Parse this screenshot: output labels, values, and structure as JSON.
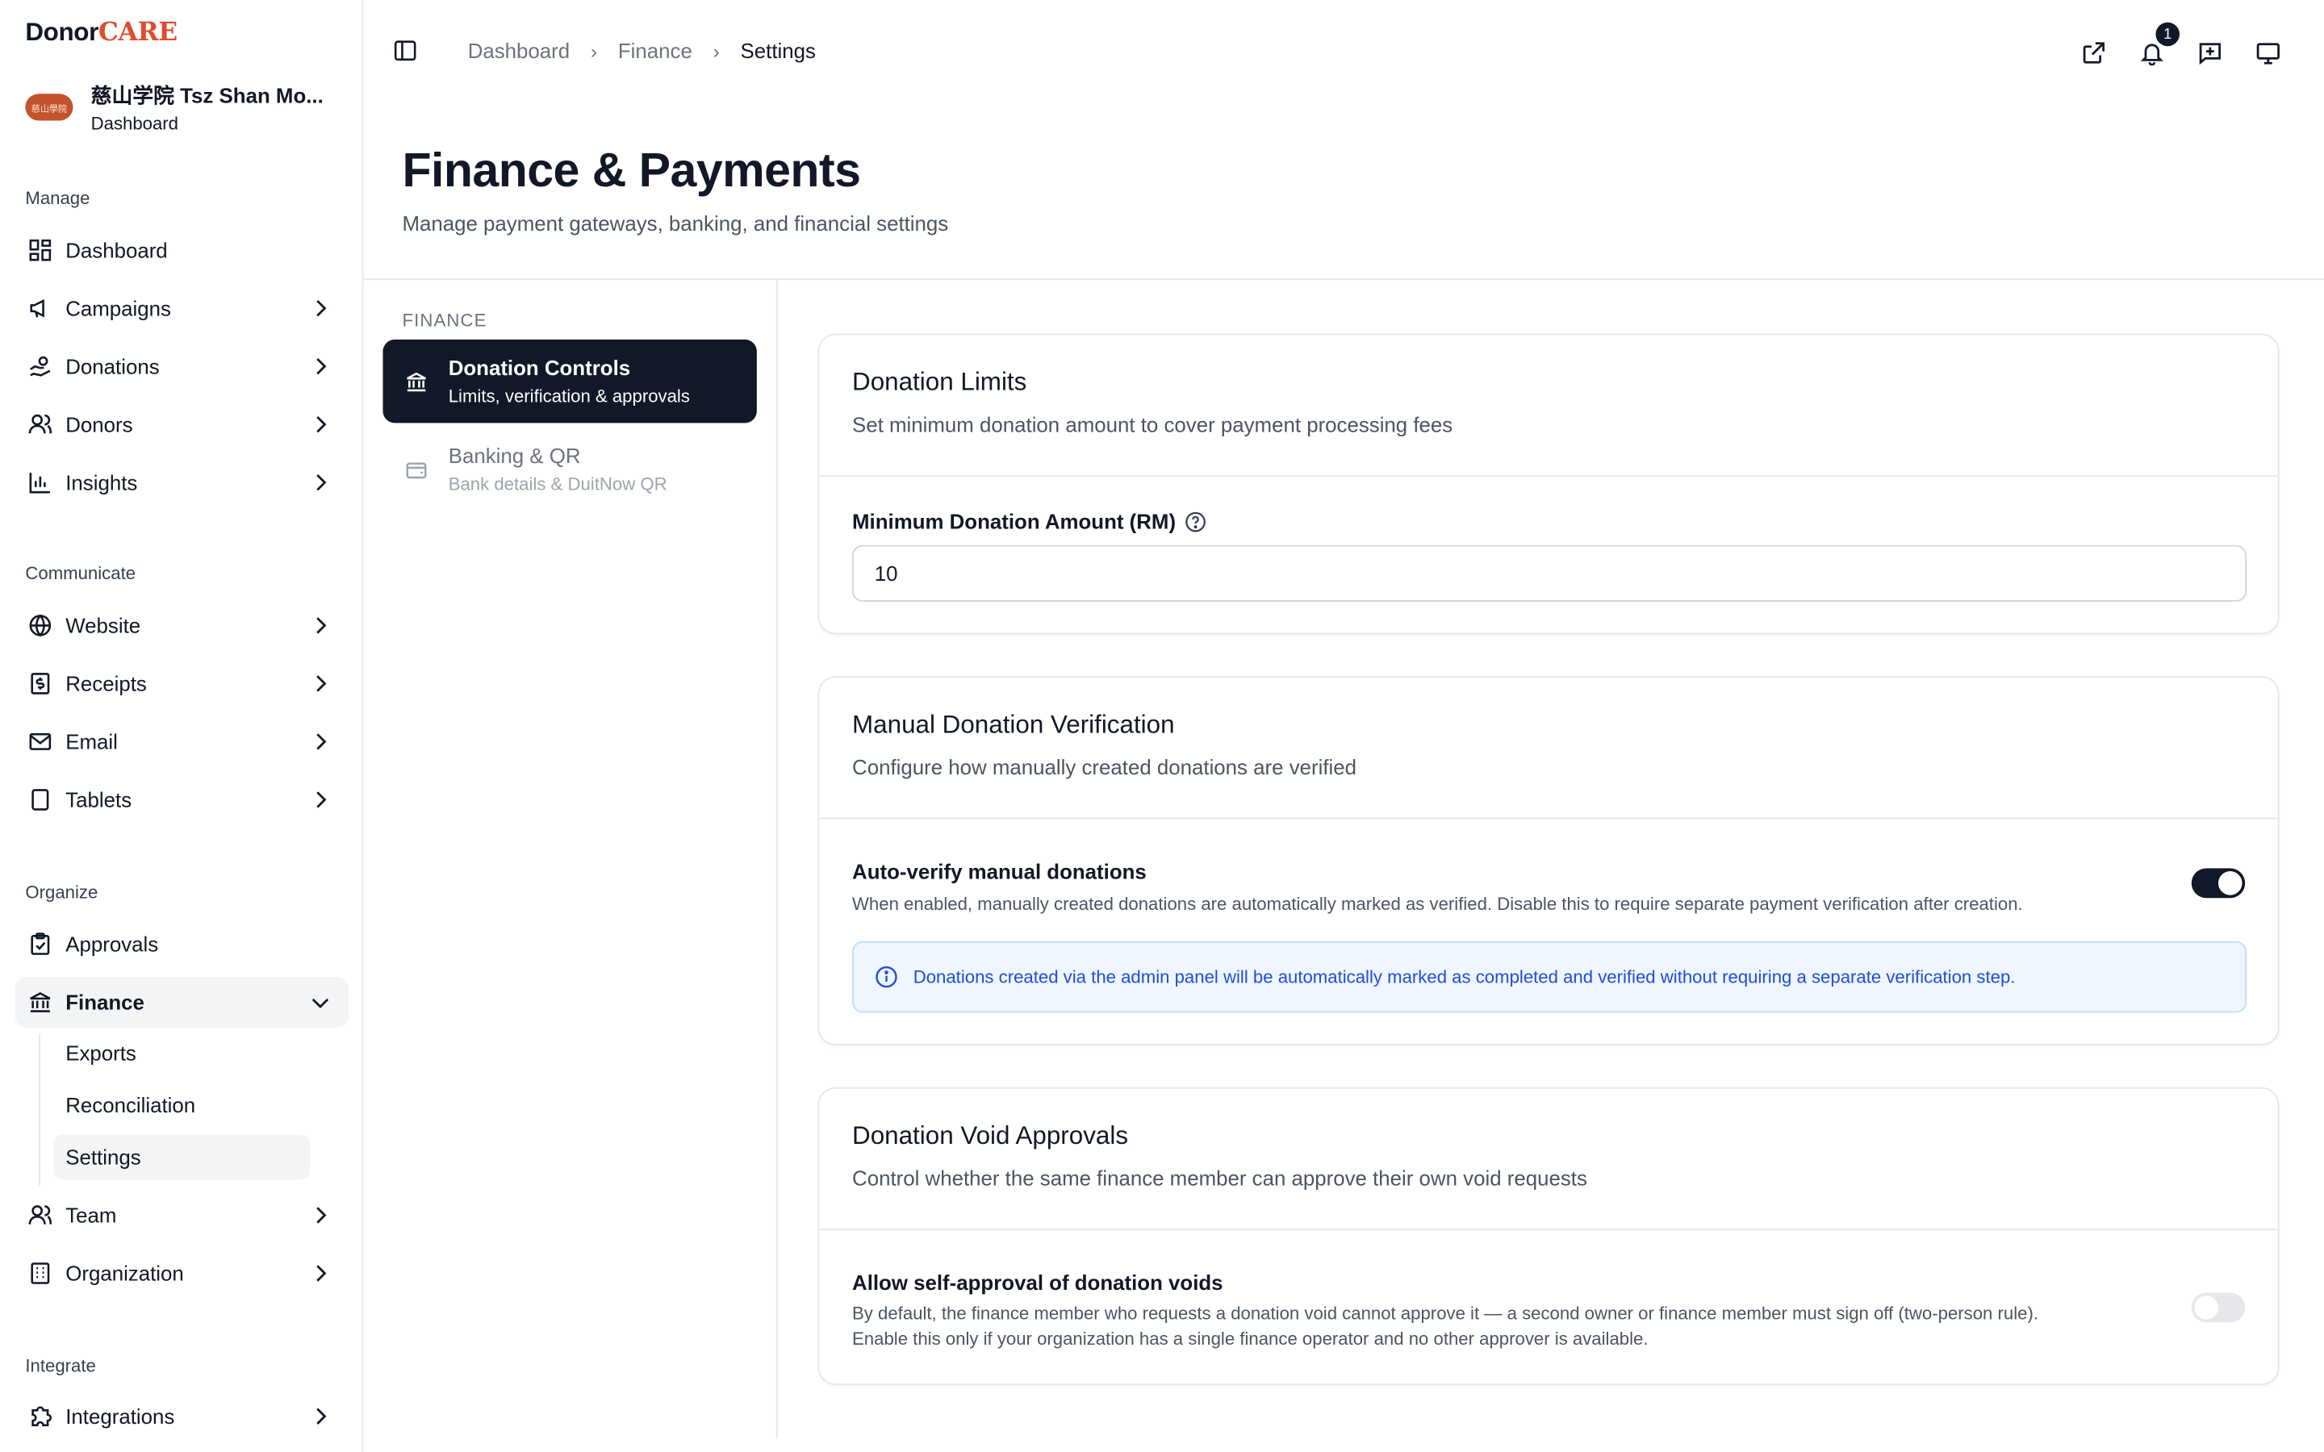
{
  "brand": {
    "part1": "Donor",
    "part2": "CARE"
  },
  "org": {
    "name": "慈山学院 Tsz Shan Mo...",
    "subtitle": "Dashboard",
    "logo_text": "慈山學院"
  },
  "sidebar": {
    "sections": {
      "manage": "Manage",
      "communicate": "Communicate",
      "organize": "Organize",
      "integrate": "Integrate"
    },
    "items": {
      "dashboard": "Dashboard",
      "campaigns": "Campaigns",
      "donations": "Donations",
      "donors": "Donors",
      "insights": "Insights",
      "website": "Website",
      "receipts": "Receipts",
      "email": "Email",
      "tablets": "Tablets",
      "approvals": "Approvals",
      "finance": "Finance",
      "team": "Team",
      "organization": "Organization",
      "integrations": "Integrations"
    },
    "finance_sub": {
      "exports": "Exports",
      "reconciliation": "Reconciliation",
      "settings": "Settings"
    }
  },
  "header": {
    "breadcrumbs": [
      "Dashboard",
      "Finance",
      "Settings"
    ],
    "notification_count": "1"
  },
  "page": {
    "title": "Finance & Payments",
    "subtitle": "Manage payment gateways, banking, and financial settings"
  },
  "settings_nav": {
    "label": "FINANCE",
    "items": [
      {
        "title": "Donation Controls",
        "subtitle": "Limits, verification & approvals",
        "active": true
      },
      {
        "title": "Banking & QR",
        "subtitle": "Bank details & DuitNow QR",
        "active": false
      }
    ]
  },
  "cards": {
    "limits": {
      "title": "Donation Limits",
      "description": "Set minimum donation amount to cover payment processing fees",
      "field_label": "Minimum Donation Amount (RM)",
      "field_value": "10"
    },
    "verification": {
      "title": "Manual Donation Verification",
      "description": "Configure how manually created donations are verified",
      "setting_title": "Auto-verify manual donations",
      "setting_desc": "When enabled, manually created donations are automatically marked as verified. Disable this to require separate payment verification after creation.",
      "enabled": true,
      "info": "Donations created via the admin panel will be automatically marked as completed and verified without requiring a separate verification step."
    },
    "voids": {
      "title": "Donation Void Approvals",
      "description": "Control whether the same finance member can approve their own void requests",
      "setting_title": "Allow self-approval of donation voids",
      "setting_desc_1": "By default, the finance member who requests a donation void cannot approve it — a second owner or finance member must sign off (two-person rule).",
      "setting_desc_2": "Enable this only if your organization has a single finance operator and no other approver is available.",
      "enabled": false
    }
  },
  "colors": {
    "brand_accent": "#e04a2f",
    "dark": "#111827",
    "info_text": "#1d4ed8",
    "info_bg": "#eff6ff"
  }
}
